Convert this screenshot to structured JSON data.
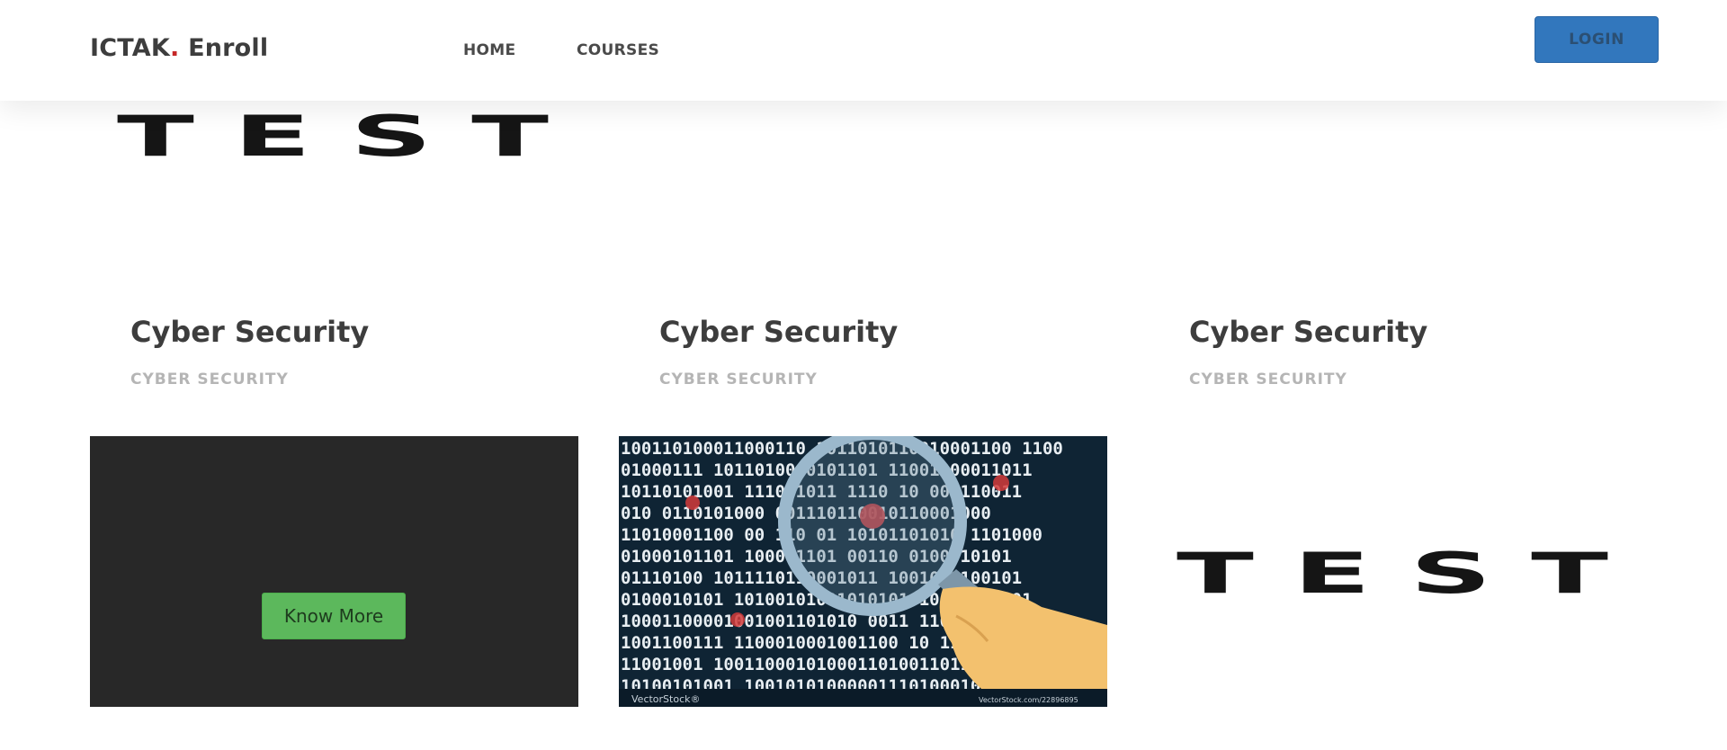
{
  "navbar": {
    "brand_main": "ICTAK",
    "brand_dot": ".",
    "brand_rest": "Enroll",
    "links": [
      {
        "label": "HOME"
      },
      {
        "label": "COURSES"
      }
    ],
    "login_label": "LOGIN"
  },
  "banner": {
    "image_text": "TEST"
  },
  "courses": [
    {
      "title": "Cyber Security",
      "category": "CYBER SECURITY",
      "image": "dark-placeholder",
      "button_label": "Know More"
    },
    {
      "title": "Cyber Security",
      "category": "CYBER SECURITY",
      "image": "binary-magnifier-illustration",
      "watermark_left": "VectorStock®",
      "watermark_right": "VectorStock.com/22896895"
    },
    {
      "title": "Cyber Security",
      "category": "CYBER SECURITY",
      "image": "test-text-image",
      "image_text": "TEST"
    }
  ],
  "colors": {
    "brand_dot": "#c62828",
    "login_bg": "#3277bd",
    "know_more_bg": "#5cb85c",
    "card1_bg": "#282828",
    "text_dark": "#3d3d3d",
    "text_muted": "#b5b5b5"
  }
}
